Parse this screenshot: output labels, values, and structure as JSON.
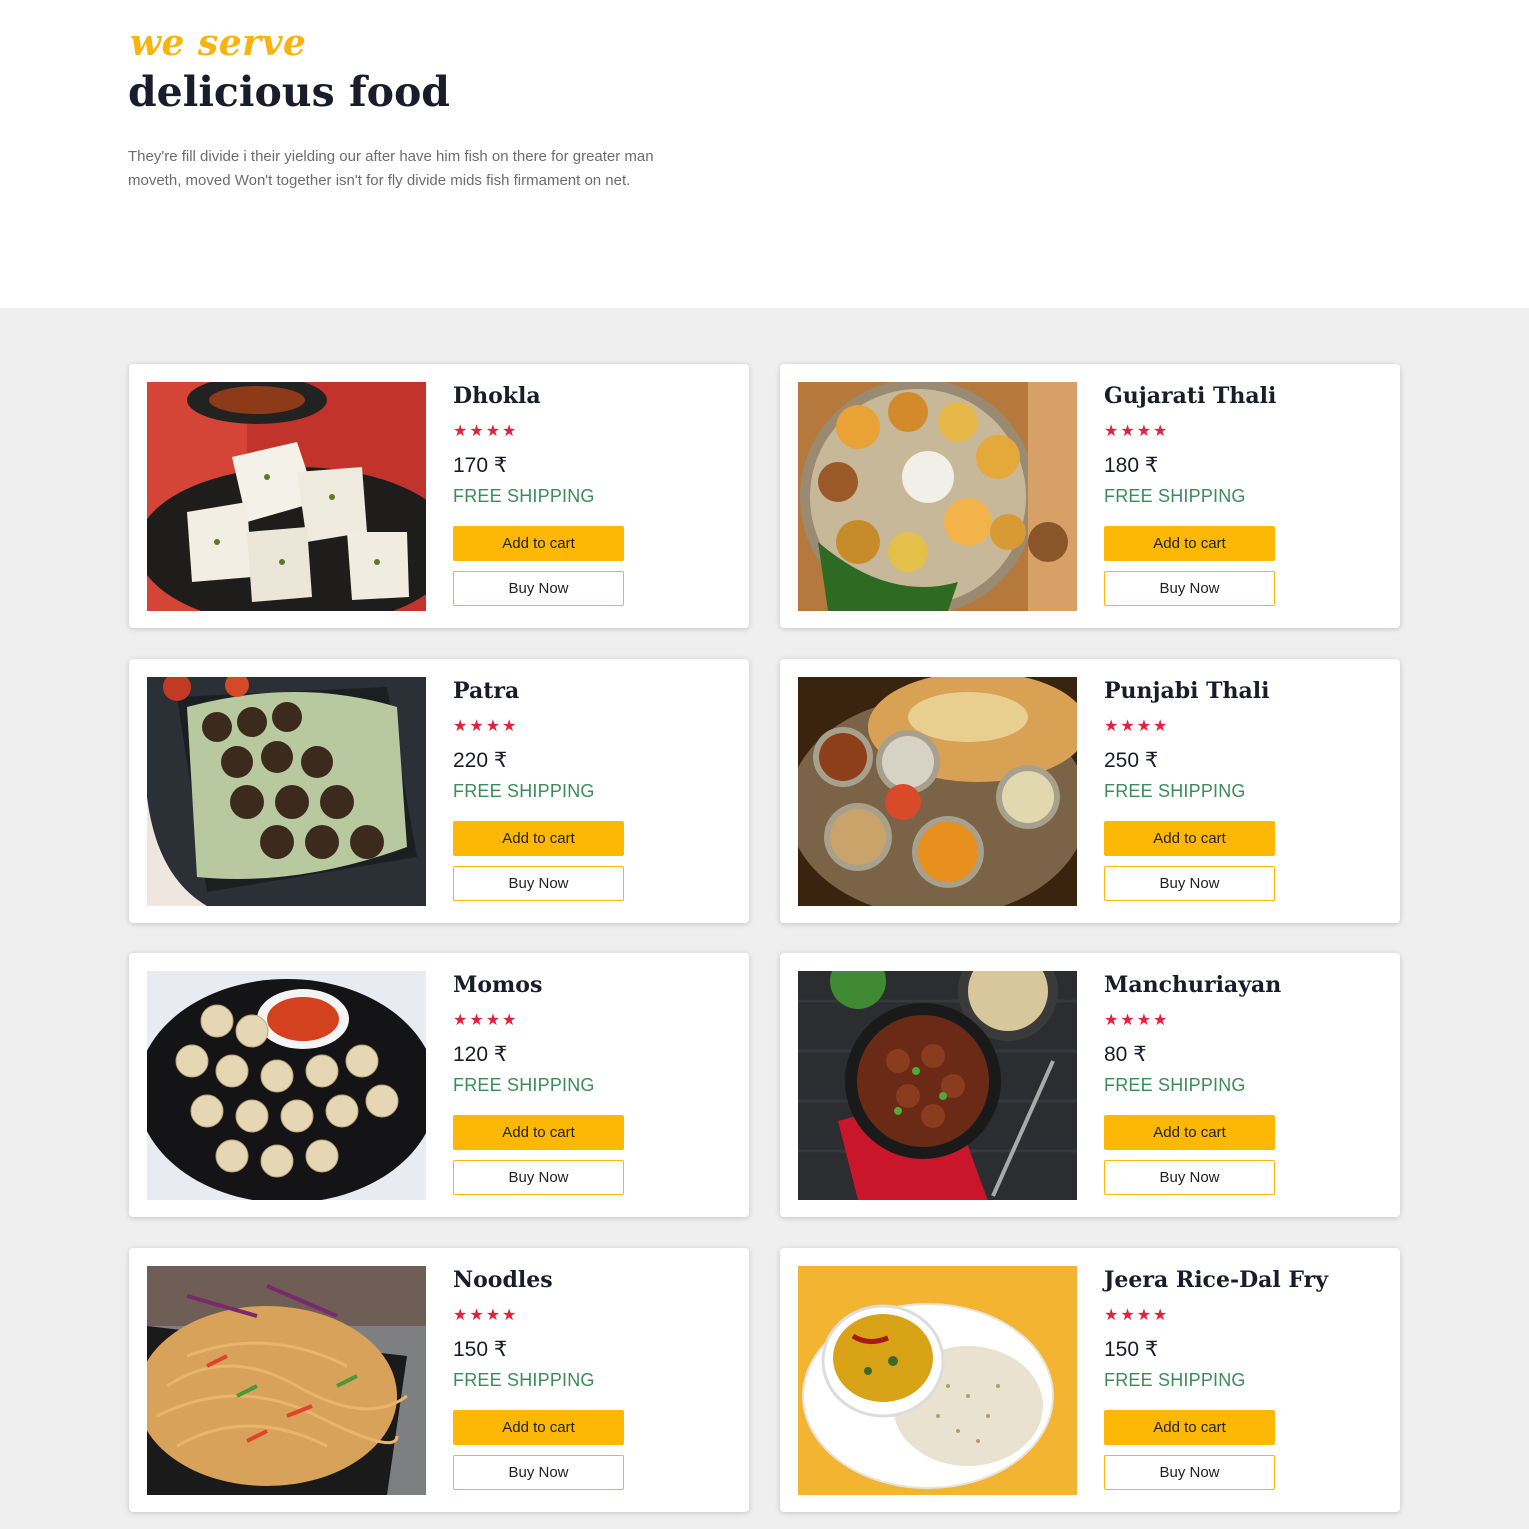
{
  "hero": {
    "kicker": "we serve",
    "title": "delicious food",
    "description": "They're fill divide i their yielding our after have him fish on there for greater man moveth, moved Won't together isn't for fly divide mids fish firmament on net."
  },
  "colors": {
    "accent": "#fcb805",
    "star": "#e0233d",
    "shipping": "#3b8c5a",
    "background": "#efefef"
  },
  "cards": [
    {
      "name": "Dhokla",
      "stars": "★★★★",
      "rating": 4,
      "price": "170 ₹",
      "shipping": "FREE SHIPPING",
      "add_to_cart": "Add to cart",
      "buy_now": "Buy Now"
    },
    {
      "name": "Gujarati Thali",
      "stars": "★★★★",
      "rating": 4,
      "price": "180 ₹",
      "shipping": "FREE SHIPPING",
      "add_to_cart": "Add to cart",
      "buy_now": "Buy Now"
    },
    {
      "name": "Patra",
      "stars": "★★★★",
      "rating": 4,
      "price": "220 ₹",
      "shipping": "FREE SHIPPING",
      "add_to_cart": "Add to cart",
      "buy_now": "Buy Now"
    },
    {
      "name": "Punjabi Thali",
      "stars": "★★★★",
      "rating": 4,
      "price": "250 ₹",
      "shipping": "FREE SHIPPING",
      "add_to_cart": "Add to cart",
      "buy_now": "Buy Now"
    },
    {
      "name": "Momos",
      "stars": "★★★★",
      "rating": 4,
      "price": "120 ₹",
      "shipping": "FREE SHIPPING",
      "add_to_cart": "Add to cart",
      "buy_now": "Buy Now"
    },
    {
      "name": "Manchuriayan",
      "stars": "★★★★",
      "rating": 4,
      "price": "80 ₹",
      "shipping": "FREE SHIPPING",
      "add_to_cart": "Add to cart",
      "buy_now": "Buy Now"
    },
    {
      "name": "Noodles",
      "stars": "★★★★",
      "rating": 4,
      "price": "150 ₹",
      "shipping": "FREE SHIPPING",
      "add_to_cart": "Add to cart",
      "buy_now": "Buy Now"
    },
    {
      "name": "Jeera Rice-Dal Fry",
      "stars": "★★★★",
      "rating": 4,
      "price": "150 ₹",
      "shipping": "FREE SHIPPING",
      "add_to_cart": "Add to cart",
      "buy_now": "Buy Now"
    }
  ]
}
